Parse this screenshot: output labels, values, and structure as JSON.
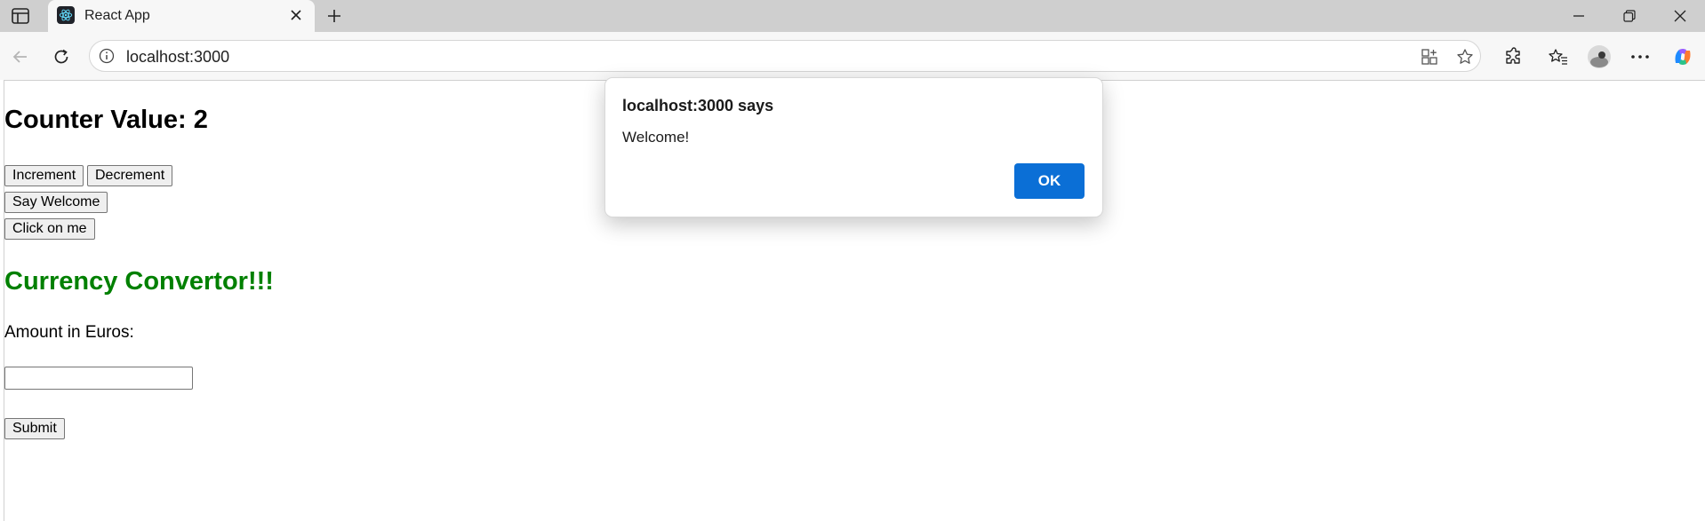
{
  "browser": {
    "tab_title": "React App",
    "url": "localhost:3000"
  },
  "page": {
    "counter_heading": "Counter Value: 2",
    "increment_label": "Increment",
    "decrement_label": "Decrement",
    "say_welcome_label": "Say Welcome",
    "click_me_label": "Click on me",
    "currency_heading": "Currency Convertor!!!",
    "amount_label": "Amount in Euros:",
    "amount_value": "",
    "submit_label": "Submit"
  },
  "dialog": {
    "title": "localhost:3000 says",
    "message": "Welcome!",
    "ok_label": "OK"
  },
  "colors": {
    "currency_heading": "#008000",
    "ok_button": "#0b6fd6"
  }
}
